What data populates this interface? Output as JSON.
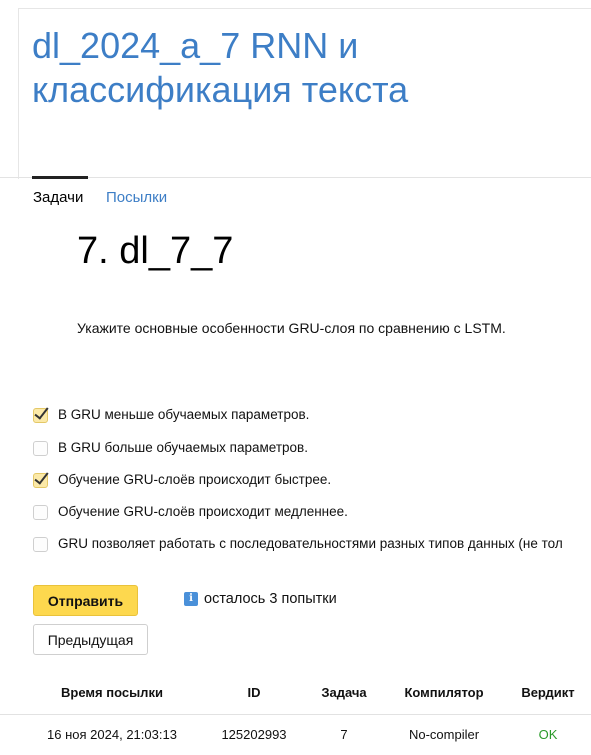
{
  "contest": {
    "title": "dl_2024_a_7 RNN и классификация текста"
  },
  "tabs": [
    {
      "label": "Задачи",
      "active": true
    },
    {
      "label": "Посылки",
      "active": false
    }
  ],
  "problem": {
    "title": "7. dl_7_7",
    "statement": "Укажите основные особенности GRU-слоя по сравнению с LSTM."
  },
  "options": [
    {
      "label": "В GRU меньше обучаемых параметров.",
      "checked": true
    },
    {
      "label": "В GRU больше обучаемых параметров.",
      "checked": false
    },
    {
      "label": "Обучение GRU-слоёв происходит быстрее.",
      "checked": true
    },
    {
      "label": "Обучение GRU-слоёв происходит медленнее.",
      "checked": false
    },
    {
      "label": "GRU позволяет работать с последовательностями разных типов данных (не тол",
      "checked": false
    }
  ],
  "actions": {
    "submit_label": "Отправить",
    "attempts_text": "осталось 3 попытки",
    "prev_label": "Предыдущая"
  },
  "submissions": {
    "headers": [
      "Время посылки",
      "ID",
      "Задача",
      "Компилятор",
      "Вердикт"
    ],
    "rows": [
      [
        "16 ноя 2024, 21:03:13",
        "125202993",
        "7",
        "No-compiler",
        "OK"
      ]
    ]
  },
  "colors": {
    "link": "#3d7ec6",
    "submit_bg": "#fdd84e",
    "verdict_ok": "#2a9a2a"
  },
  "icons": {
    "attempts_icon": "info-icon"
  }
}
